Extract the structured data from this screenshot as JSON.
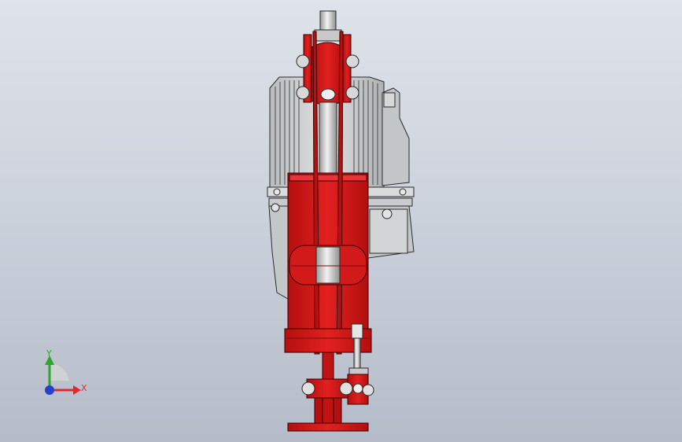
{
  "triad": {
    "x_label": "X",
    "y_label": "Y",
    "x_color": "#e0292b",
    "y_color": "#2fa52f",
    "z_color": "#2a3fc7"
  },
  "colors": {
    "part_red": "#d81a1a",
    "part_red_dark": "#8a0d0d",
    "housing_gray": "#cfd2d4",
    "edge": "#2a2a2a"
  },
  "icons": {
    "triad": "axis-triad-icon"
  }
}
